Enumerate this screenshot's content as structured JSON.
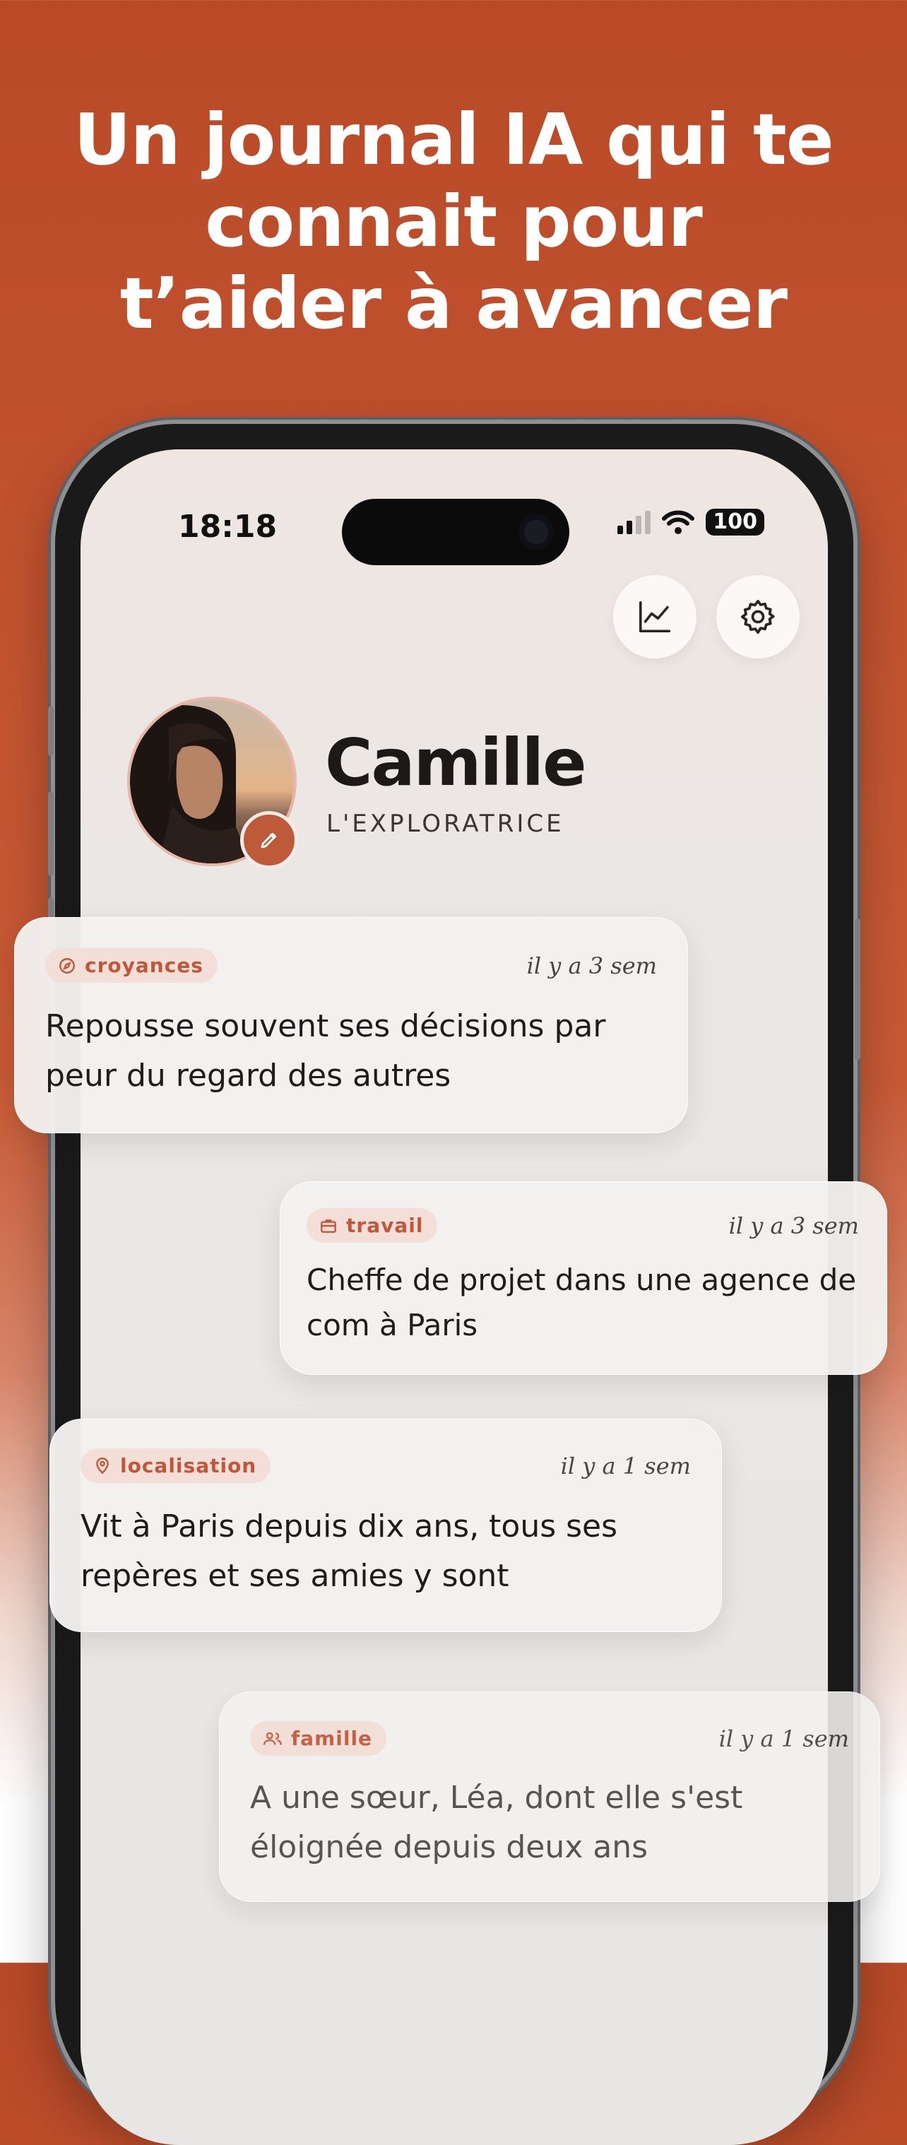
{
  "headline": {
    "line1": "Un journal IA qui te",
    "line2": "connait pour",
    "line3": "t’aider à avancer"
  },
  "status_bar": {
    "time": "18:18",
    "battery": "100",
    "icons": [
      "cellular-signal-icon",
      "wifi-icon",
      "battery-icon"
    ]
  },
  "header_actions": {
    "icons": [
      "chart-line-icon",
      "gear-icon"
    ]
  },
  "profile": {
    "name": "Camille",
    "subtitle": "L'EXPLORATRICE"
  },
  "cards": [
    {
      "tag": "croyances",
      "tag_icon": "compass-icon",
      "time": "il y a 3 sem",
      "text": "Repousse souvent ses décisions par peur du regard des autres"
    },
    {
      "tag": "travail",
      "tag_icon": "briefcase-icon",
      "time": "il y a 3 sem",
      "text": "Cheffe de projet dans une agence de com à Paris"
    },
    {
      "tag": "localisation",
      "tag_icon": "location-pin-icon",
      "time": "il y a 1 sem",
      "text": "Vit à Paris depuis dix ans, tous ses repères et ses amies y sont"
    },
    {
      "tag": "famille",
      "tag_icon": "people-icon",
      "time": "il y a 1 sem",
      "text": "A une sœur, Léa, dont elle s'est éloignée depuis deux ans"
    }
  ],
  "colors": {
    "brand": "#c2532f",
    "tag_bg": "#f3dfd7",
    "tag_text": "#c0573a"
  }
}
